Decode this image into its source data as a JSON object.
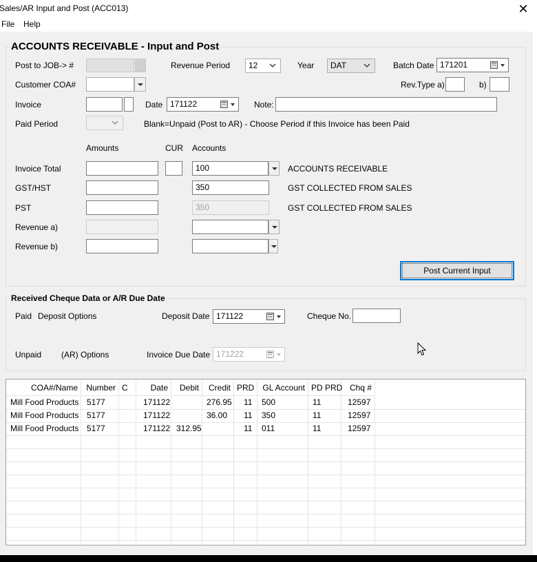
{
  "window": {
    "title": "Sales/AR Input and Post (ACC013)",
    "close_glyph": "✕"
  },
  "menu": {
    "items": [
      "File",
      "Help"
    ]
  },
  "ar_group": {
    "title": "ACCOUNTS RECEIVABLE - Input and Post",
    "post_to_job_label": "Post to JOB-> #",
    "revenue_period_label": "Revenue Period",
    "revenue_period_value": "12",
    "year_label": "Year",
    "year_value": "DAT",
    "batch_date_label": "Batch Date",
    "batch_date_value": "171201",
    "customer_coa_label": "Customer COA#",
    "customer_coa_value": "",
    "rev_type_a_label": "Rev.Type a)",
    "rev_type_a_value": "",
    "rev_type_b_label": "b)",
    "rev_type_b_value": "",
    "invoice_label": "Invoice",
    "invoice_value": "",
    "invoice_suffix_value": "",
    "date_label": "Date",
    "date_value": "171122",
    "note_label": "Note:",
    "note_value": "",
    "paid_period_label": "Paid Period",
    "paid_period_value": "",
    "paid_period_hint": "Blank=Unpaid (Post to AR) - Choose Period if this Invoice has been Paid",
    "col_amounts": "Amounts",
    "col_cur": "CUR",
    "col_accounts": "Accounts",
    "rows": [
      {
        "label": "Invoice Total",
        "amount": "",
        "cur": "",
        "account": "100",
        "account_desc": "ACCOUNTS RECEIVABLE"
      },
      {
        "label": "GST/HST",
        "amount": "",
        "account": "350",
        "account_desc": "GST COLLECTED FROM SALES"
      },
      {
        "label": "PST",
        "amount": "",
        "account": "350",
        "account_desc": "GST COLLECTED FROM SALES"
      },
      {
        "label": "Revenue a)",
        "amount": "",
        "account": "",
        "account_desc": ""
      },
      {
        "label": "Revenue b)",
        "amount": "",
        "account": "",
        "account_desc": ""
      }
    ],
    "post_button_label": "Post Current Input"
  },
  "cheque_group": {
    "title": "Received Cheque Data or A/R Due Date",
    "paid_label": "Paid",
    "deposit_options_label": "Deposit Options",
    "deposit_date_label": "Deposit Date",
    "deposit_date_value": "171122",
    "cheque_no_label": "Cheque No.",
    "cheque_no_value": "",
    "unpaid_label": "Unpaid",
    "ar_options_label": "(AR) Options",
    "invoice_due_date_label": "Invoice Due Date",
    "invoice_due_date_value": "171222"
  },
  "grid": {
    "columns": [
      "COA#/Name",
      "Number",
      "C",
      "Date",
      "Debit",
      "Credit",
      "PRD",
      "GL Account",
      "PD PRD",
      "Chq #"
    ],
    "rows": [
      [
        "Mill Food Products",
        "5177",
        "",
        "171122",
        "",
        "276.95",
        "11",
        "500",
        "11",
        "12597"
      ],
      [
        "Mill Food Products",
        "5177",
        "",
        "171122",
        "",
        "36.00",
        "11",
        "350",
        "11",
        "12597"
      ],
      [
        "Mill Food Products",
        "5177",
        "",
        "171122",
        "312.95",
        "",
        "11",
        "011",
        "11",
        "12597"
      ]
    ]
  },
  "colors": {
    "accent": "#0078d7",
    "window_bg": "#f0f0f0",
    "outer_bg": "#000000"
  },
  "icons": [
    "close-icon",
    "chevron-down-icon",
    "calendar-icon",
    "mouse-cursor-icon"
  ]
}
